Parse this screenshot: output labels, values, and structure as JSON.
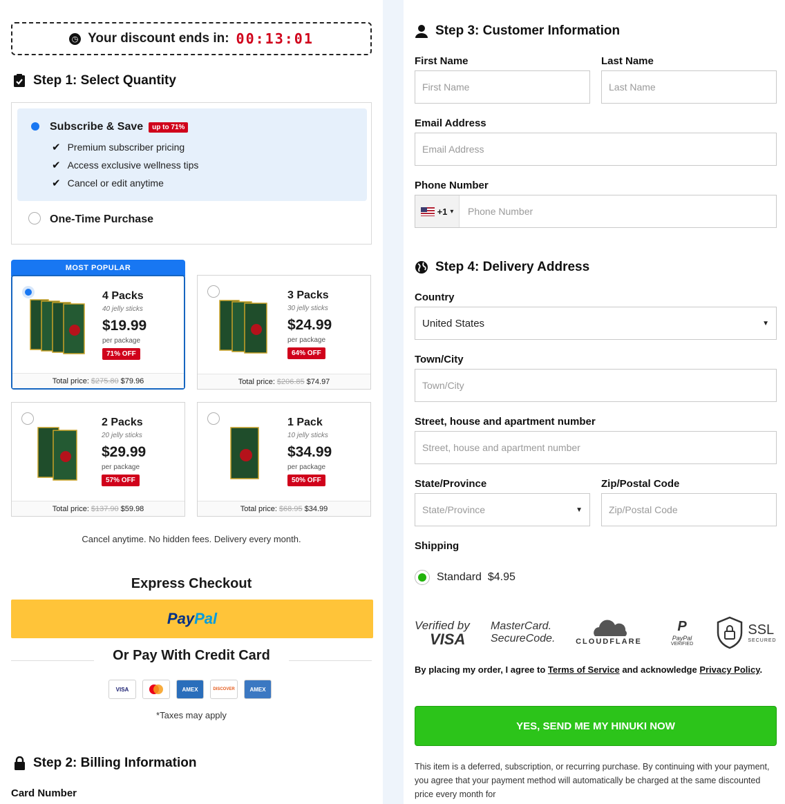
{
  "timer": {
    "label": "Your discount ends in:",
    "value": "00:13:01",
    "icon": "clock-icon"
  },
  "step1": {
    "title": "Step 1: Select Quantity",
    "subscribe": {
      "label": "Subscribe & Save",
      "badge": "up to 71%",
      "benefits": [
        "Premium subscriber pricing",
        "Access exclusive wellness tips",
        "Cancel or edit anytime"
      ]
    },
    "one_time": "One-Time Purchase"
  },
  "packs": {
    "most_popular": "MOST POPULAR",
    "items": [
      {
        "name": "4 Packs",
        "sub": "40 jelly sticks",
        "price": "$19.99",
        "per": "per package",
        "off": "71% OFF",
        "total_label": "Total price:",
        "total_old": "$275.80",
        "total": "$79.96"
      },
      {
        "name": "3 Packs",
        "sub": "30 jelly sticks",
        "price": "$24.99",
        "per": "per package",
        "off": "64% OFF",
        "total_label": "Total price:",
        "total_old": "$206.85",
        "total": "$74.97"
      },
      {
        "name": "2 Packs",
        "sub": "20 jelly sticks",
        "price": "$29.99",
        "per": "per package",
        "off": "57% OFF",
        "total_label": "Total price:",
        "total_old": "$137.90",
        "total": "$59.98"
      },
      {
        "name": "1 Pack",
        "sub": "10 jelly sticks",
        "price": "$34.99",
        "per": "per package",
        "off": "50% OFF",
        "total_label": "Total price:",
        "total_old": "$68.95",
        "total": "$34.99"
      }
    ],
    "note": "Cancel anytime. No hidden fees. Delivery every month."
  },
  "express": {
    "title": "Express Checkout",
    "paypal_a": "Pay",
    "paypal_b": "Pal"
  },
  "credit": {
    "title": "Or Pay With Credit Card",
    "cards": [
      "VISA",
      "MC",
      "AMEX",
      "DISCOVER",
      "AMEX"
    ],
    "taxes": "*Taxes may apply"
  },
  "step2": {
    "title": "Step 2: Billing Information",
    "card_number": "Card Number"
  },
  "step3": {
    "title": "Step 3: Customer Information",
    "first_name": {
      "label": "First Name",
      "placeholder": "First Name"
    },
    "last_name": {
      "label": "Last Name",
      "placeholder": "Last Name"
    },
    "email": {
      "label": "Email Address",
      "placeholder": "Email Address"
    },
    "phone": {
      "label": "Phone Number",
      "prefix": "+1",
      "placeholder": "Phone Number"
    }
  },
  "step4": {
    "title": "Step 4: Delivery Address",
    "country": {
      "label": "Country",
      "value": "United States"
    },
    "town": {
      "label": "Town/City",
      "placeholder": "Town/City"
    },
    "street": {
      "label": "Street, house and apartment number",
      "placeholder": "Street, house and apartment number"
    },
    "state": {
      "label": "State/Province",
      "placeholder": "State/Province"
    },
    "zip": {
      "label": "Zip/Postal Code",
      "placeholder": "Zip/Postal Code"
    },
    "shipping": {
      "label": "Shipping",
      "option": "Standard",
      "price": "$4.95"
    }
  },
  "trust": {
    "visa_a": "Verified by",
    "visa_b": "VISA",
    "mc_a": "MasterCard.",
    "mc_b": "SecureCode.",
    "cloudflare": "CLOUDFLARE",
    "paypal_a": "PayPal",
    "paypal_b": "VERIFIED",
    "ssl_a": "SSL",
    "ssl_b": "SECURED"
  },
  "legal": {
    "pre": "By placing my order, I agree to ",
    "terms": "Terms of Service",
    "mid": " and acknowledge ",
    "privacy": "Privacy Policy",
    "post": "."
  },
  "cta": "YES, SEND ME MY HINUKI NOW",
  "disclaimer": "This item is a deferred, subscription, or recurring purchase. By continuing with your payment, you agree that your payment method will automatically be charged at the same discounted price every month for",
  "colors": {
    "accent": "#1877f2",
    "red": "#d0021b",
    "paypal": "#ffc439",
    "cta": "#2cc41a"
  }
}
